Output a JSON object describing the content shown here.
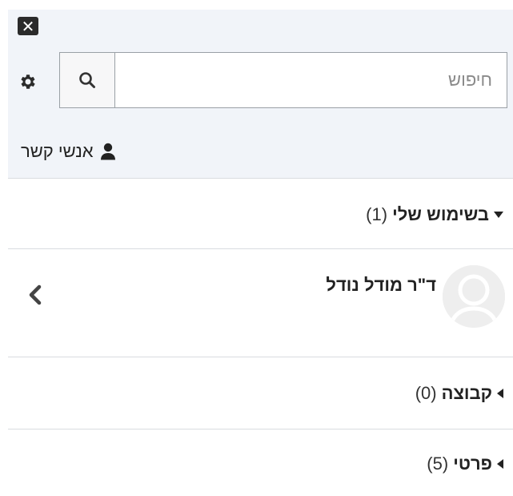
{
  "drawer": {
    "close_icon_glyph": "✕"
  },
  "search": {
    "placeholder": "חיפוש",
    "value": ""
  },
  "contacts_link": {
    "label": "אנשי קשר"
  },
  "sections": [
    {
      "title": "בשימוש שלי",
      "count": "(1)",
      "expanded": true
    },
    {
      "title": "קבוצה",
      "count": "(0)",
      "expanded": false
    },
    {
      "title": "פרטי",
      "count": "(5)",
      "expanded": false
    }
  ],
  "contact": {
    "name": "ד\"ר מודל נודל"
  },
  "colors": {
    "header_bg": "#f1f4f9",
    "divider": "#d9dce0",
    "text": "#222222"
  },
  "icons": [
    "close-icon",
    "gear-icon",
    "search-icon",
    "user-icon",
    "caret-down-icon",
    "caret-left-icon",
    "chevron-left-icon",
    "avatar-placeholder-icon"
  ]
}
